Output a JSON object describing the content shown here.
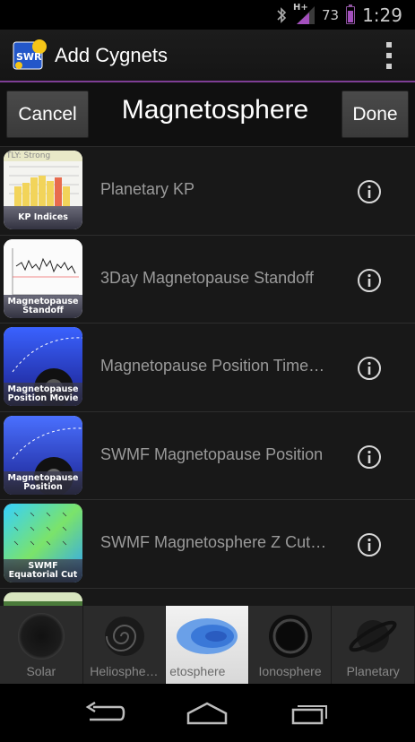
{
  "status_bar": {
    "network": "H+",
    "battery": "73",
    "time": "1:29"
  },
  "action_bar": {
    "title": "Add Cygnets",
    "icon_text": "SWR"
  },
  "header": {
    "cancel_label": "Cancel",
    "title": "Magnetosphere",
    "done_label": "Done"
  },
  "list": [
    {
      "thumb_caption": "KP Indices",
      "thumb_text": "TLY: Strong",
      "label": "Planetary KP"
    },
    {
      "thumb_caption": "Magnetopause Standoff",
      "label": "3Day Magnetopause Standoff"
    },
    {
      "thumb_caption": "Magnetopause Position Movie",
      "label": "Magnetopause Position Time…"
    },
    {
      "thumb_caption": "Magnetopause Position",
      "label": "SWMF Magnetopause Position"
    },
    {
      "thumb_caption": "SWMF Equatorial Cut",
      "label": "SWMF Magnetosphere Z Cut…"
    }
  ],
  "tabs": [
    {
      "label": "Solar",
      "icon": "sun-icon"
    },
    {
      "label": "Heliosphe…",
      "icon": "spiral-icon"
    },
    {
      "label": "etosphere",
      "icon": "magnetosphere-icon",
      "selected": true
    },
    {
      "label": "Ionosphere",
      "icon": "ring-icon"
    },
    {
      "label": "Planetary",
      "icon": "planet-icon"
    }
  ],
  "nav": {
    "back": "back-icon",
    "home": "home-icon",
    "recents": "recents-icon"
  },
  "colors": {
    "accent": "#7e3e95",
    "background": "#181818",
    "text_secondary": "#9a9a9a"
  }
}
